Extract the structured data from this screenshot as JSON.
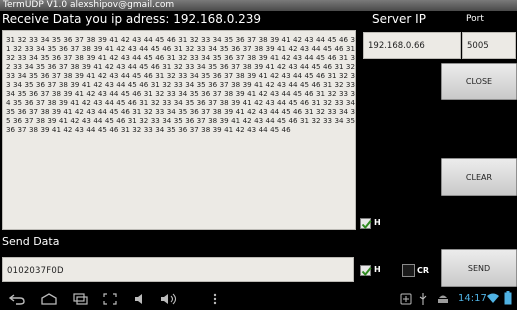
{
  "window": {
    "title": "TermUDP V1.0   alexshipov@gmail.com"
  },
  "receive": {
    "label": "Receive Data  you ip adress: 192.168.0.239",
    "content": "31 32 33 34 35 36 37 38 39 41 42 43 44 45 46 31 32 33 34 35 36 37 38 39 41 42 43 44 45 46 31 32 33 34 35 36 37 38 39 41 42 43 44 45 46 31 32 33 34 35 36 37 38 39 41 42 43 44 45 46 31 32 33 34 35 36 37 38 39 41 42 43 44 45 46 31 32 33 34 35 36 37 38 39 41 42 43 44 45 46 31 32 33 34 35 36 37 38 39 41 42 43 44 45 46 31 32 33 34 35 36 37 38 39 41 42 43 44 45 46 31 32 33 34 35 36 37 38 39 41 42 43 44 45 46 31 32 33 34 35 36 37 38 39 41 42 43 44 45 46 31 32 33 34 35 36 37 38 39 41 42 43 44 45 46 31 32 33 34 35 36 37 38 39 41 42 43 44 45 46 31 32 33 34 35 36 37 38 39 41 42 43 44 45 46 31 32 33 34 35 36 37 38 39 41 42 43 44 45 46 31 32 33 34 35 36 37 38 39 41 42 43 44 45 46 31 32 33 34 35 36 37 38 39 41 42 43 44 45 46 31 32 33 34 35 36 37 38 39 41 42 43 44 45 46 31 32 33 34 35 36 37 38 39 41 42 43 44 45 46 31 32 33 34 35 36 37 38 39 41 42 43 44 45 46 31 32 33 34 35 36 37 38 39 41 42 43 44 45 46 31 32 33 34 35 36 37 38 39 41 42 43 44 45 46 31 32 33 34 35 36 37 38 39 41 42 43 44 45 46",
    "hex_checkbox_label": "H",
    "hex_checked": true
  },
  "server": {
    "label": "Server IP",
    "port_label": "Port",
    "ip_value": "192.168.0.66",
    "port_value": "5005"
  },
  "buttons": {
    "close": "CLOSE",
    "clear": "CLEAR",
    "send": "SEND"
  },
  "send": {
    "label": "Send Data",
    "value": "0102037F0D",
    "hex_checkbox_label": "H",
    "hex_checked": true,
    "cr_checkbox_label": "CR",
    "cr_checked": false
  },
  "statusbar": {
    "time": "14:17"
  },
  "colors": {
    "accent_blue": "#4fb2e3",
    "check_green": "#2f8a1f"
  }
}
